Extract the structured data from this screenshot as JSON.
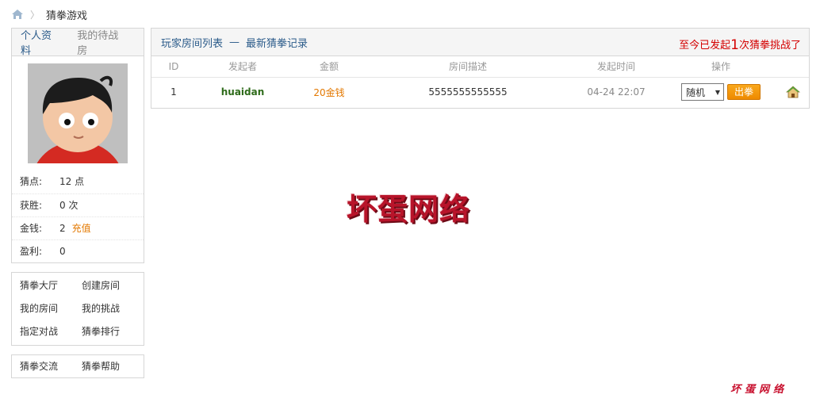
{
  "breadcrumb": {
    "current": "猜拳游戏",
    "separator": "〉"
  },
  "sidebar": {
    "tabs": [
      "个人资料",
      "我的待战房"
    ],
    "stats": [
      {
        "label": "猜点:",
        "value": "12 点"
      },
      {
        "label": "获胜:",
        "value": "0 次"
      },
      {
        "label": "金钱:",
        "value": "2",
        "action": "充值"
      },
      {
        "label": "盈利:",
        "value": "0"
      }
    ],
    "menu": [
      [
        "猜拳大厅",
        "创建房间"
      ],
      [
        "我的房间",
        "我的挑战"
      ],
      [
        "指定对战",
        "猜拳排行"
      ]
    ],
    "menu2": [
      [
        "猜拳交流",
        "猜拳帮助"
      ]
    ]
  },
  "main": {
    "tab_rooms": "玩家房间列表",
    "dash": "—",
    "tab_records": "最新猜拳记录",
    "challenge_prefix": "至今已发起",
    "challenge_count": "1",
    "challenge_suffix": "次猜拳挑战了",
    "columns": [
      "ID",
      "发起者",
      "金额",
      "房间描述",
      "发起时间",
      "操作"
    ],
    "rows": [
      {
        "id": "1",
        "user": "huaidan",
        "amount": "20金钱",
        "desc": "5555555555555",
        "time": "04-24 22:07",
        "select": "随机",
        "button": "出拳"
      }
    ]
  },
  "watermark": "坏蛋网络",
  "watermark_small": "坏蛋网络",
  "colors": {
    "link": "#2b5b8a",
    "accent": "#e37800",
    "alert": "#d40000",
    "user": "#2e6b1a"
  }
}
